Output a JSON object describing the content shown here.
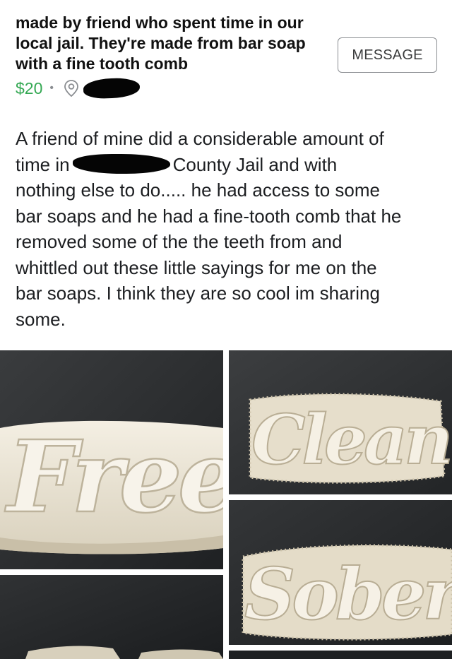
{
  "listing": {
    "title_lines": [
      "made by friend who spent time in our",
      "local jail. They're made from bar soap",
      "with a fine tooth comb"
    ],
    "price": "$20",
    "separator": "•",
    "message_label": "MESSAGE"
  },
  "description": {
    "line1": "A friend of mine did a considerable amount of",
    "line2_start": "time in",
    "line2_end": "County Jail and with",
    "line3": "nothing else to do..... he had access to some",
    "line4": "bar soaps and he had a fine-tooth comb that he",
    "line5": "removed some of the the teeth from and",
    "line6": "whittled out these little sayings for me on the",
    "line7": "bar soaps. I think they are so cool im sharing",
    "line8": "some."
  },
  "photos": [
    {
      "carved_word": "Free"
    },
    {
      "carved_word": "Clean"
    },
    {
      "carved_word": "Sober"
    },
    {
      "carved_word": ""
    }
  ],
  "colors": {
    "price_green": "#34a853",
    "soap_cream": "#ece6d6",
    "fabric_dark": "#2c2e30"
  }
}
